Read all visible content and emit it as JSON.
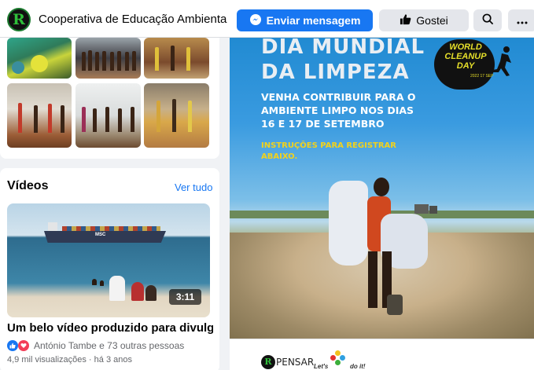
{
  "header": {
    "logo_letter": "R",
    "page_name": "Cooperativa de Educação Ambiental ...",
    "send_message_label": "Enviar mensagem",
    "liked_label": "Gostei",
    "search_icon": "search-icon",
    "more_icon": "more-icon"
  },
  "videos": {
    "title": "Vídeos",
    "see_all": "Ver tudo",
    "duration": "3:11",
    "caption": "Um belo vídeo produzido para divulgar ...",
    "reactions_text": "António Tambe e 73 outras pessoas",
    "meta": "4,9 mil visualizações · há 3 anos",
    "ship_mark": "MSC"
  },
  "post": {
    "title_line1": "DIA MUNDIAL",
    "title_line2": "DA LIMPEZA",
    "body_line1": "VENHA CONTRIBUIR PARA O",
    "body_line2": "AMBIENTE LIMPO NOS DIAS",
    "body_line3": "16 E 17 DE SETEMBRO",
    "instructions_line1": "INSTRUÇÕES PARA REGISTRAR",
    "instructions_line2": "ABAIXO.",
    "badge_line1": "WORLD",
    "badge_line2": "CLEANUP",
    "badge_line3": "DAY",
    "badge_year": "2022 17 SEP",
    "footer_logo_letter": "R",
    "footer_pensar": "PENSAR",
    "footer_letsdoit": "Let's",
    "footer_doit": "do it!"
  },
  "colors": {
    "accent": "#1877f2",
    "poster_yellow": "#f2d21c"
  }
}
